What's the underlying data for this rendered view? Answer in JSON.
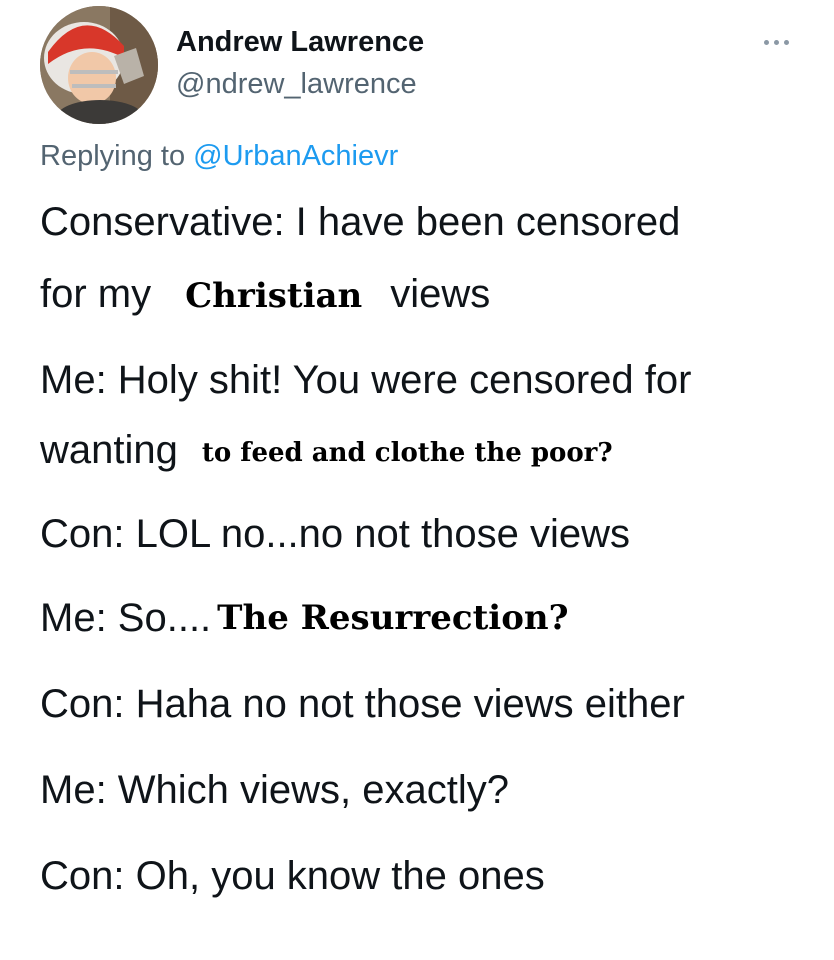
{
  "author": {
    "display_name": "Andrew Lawrence",
    "handle": "@ndrew_lawrence"
  },
  "more_icon": "more-horizontal-icon",
  "reply": {
    "prefix": "Replying to",
    "mention": "@UrbanAchievr"
  },
  "tweet": {
    "line1": "Conservative: I have been censored",
    "line2_start": "for my",
    "line2_overlay": "Christian",
    "line2_end": "views",
    "line3": "Me: Holy shit! You were censored for",
    "line4_start": "wanting",
    "line4_overlay": "to feed and clothe the poor?",
    "line5": "Con: LOL no...no not those views",
    "line6_start": "Me: So....",
    "line6_overlay": "The Resurrection?",
    "line7": "Con: Haha no not those views either",
    "line8": "Me: Which views, exactly?",
    "line9": "Con: Oh, you know the ones"
  },
  "colors": {
    "primary_text": "#0f1419",
    "secondary_text": "#536471",
    "mention": "#1d9bf0"
  }
}
